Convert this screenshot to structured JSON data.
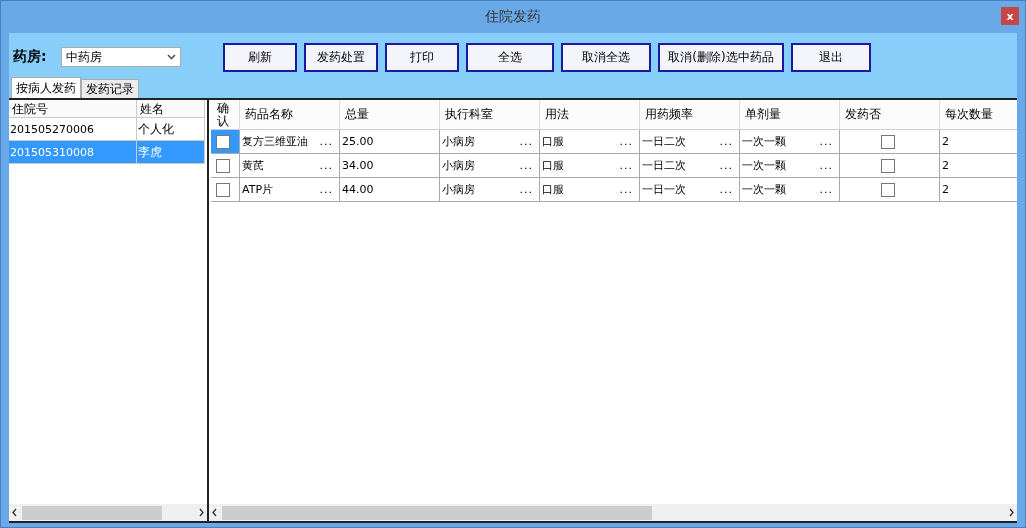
{
  "window": {
    "title": "住院发药",
    "close": "x"
  },
  "pharmacy": {
    "label": "药房:",
    "value": "中药房"
  },
  "buttons": [
    "刷新",
    "发药处置",
    "打印",
    "全选",
    "取消全选",
    "取消(删除)选中药品",
    "退出"
  ],
  "tabs": [
    {
      "label": "按病人发药",
      "selected": true
    },
    {
      "label": "发药记录",
      "selected": false
    }
  ],
  "patients": {
    "columns": [
      "住院号",
      "姓名"
    ],
    "rows": [
      {
        "id": "201505270006",
        "name": "个人化",
        "selected": false
      },
      {
        "id": "201505310008",
        "name": "李虎",
        "selected": true
      }
    ]
  },
  "drugs": {
    "columns": [
      "确认",
      "药品名称",
      "总量",
      "执行科室",
      "用法",
      "用药频率",
      "单剂量",
      "发药否",
      "每次数量"
    ],
    "rows": [
      {
        "cells": [
          {
            "kind": "check",
            "checked": false,
            "current": true
          },
          {
            "kind": "text",
            "text": "复方三维亚油",
            "more": "..."
          },
          {
            "kind": "text",
            "text": "25.00"
          },
          {
            "kind": "text",
            "text": "小病房",
            "more": "..."
          },
          {
            "kind": "text",
            "text": "口服",
            "more": "..."
          },
          {
            "kind": "text",
            "text": "一日二次",
            "more": "..."
          },
          {
            "kind": "text",
            "text": "一次一颗",
            "more": "..."
          },
          {
            "kind": "check",
            "checked": false,
            "current": false
          },
          {
            "kind": "text",
            "text": "2"
          }
        ]
      },
      {
        "cells": [
          {
            "kind": "check",
            "checked": false,
            "current": false
          },
          {
            "kind": "text",
            "text": "黄芪",
            "more": "..."
          },
          {
            "kind": "text",
            "text": "34.00"
          },
          {
            "kind": "text",
            "text": "小病房",
            "more": "..."
          },
          {
            "kind": "text",
            "text": "口服",
            "more": "..."
          },
          {
            "kind": "text",
            "text": "一日二次",
            "more": "..."
          },
          {
            "kind": "text",
            "text": "一次一颗",
            "more": "..."
          },
          {
            "kind": "check",
            "checked": false,
            "current": false
          },
          {
            "kind": "text",
            "text": "2"
          }
        ]
      },
      {
        "cells": [
          {
            "kind": "check",
            "checked": false,
            "current": false
          },
          {
            "kind": "text",
            "text": "ATP片",
            "more": "..."
          },
          {
            "kind": "text",
            "text": "44.00"
          },
          {
            "kind": "text",
            "text": "小病房",
            "more": "..."
          },
          {
            "kind": "text",
            "text": "口服",
            "more": "..."
          },
          {
            "kind": "text",
            "text": "一日一次",
            "more": "..."
          },
          {
            "kind": "text",
            "text": "一次一颗",
            "more": "..."
          },
          {
            "kind": "check",
            "checked": false,
            "current": false
          },
          {
            "kind": "text",
            "text": "2"
          }
        ]
      }
    ]
  }
}
